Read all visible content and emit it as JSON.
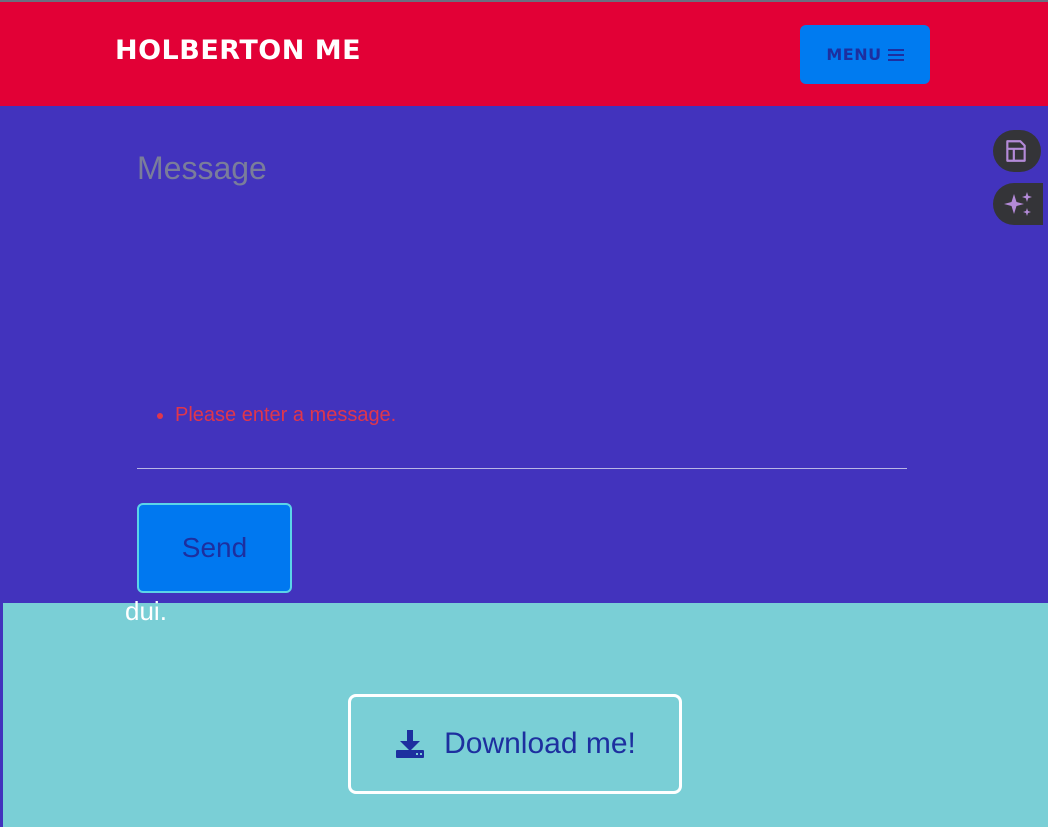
{
  "header": {
    "brand": "HOLBERTON ME",
    "menu_label": "MENU"
  },
  "contact_form": {
    "message_placeholder": "Message",
    "error_message": "Please enter a message.",
    "send_label": "Send"
  },
  "download_section": {
    "partial_text": "dui.",
    "download_label": "Download me!"
  },
  "floating_tools": {
    "icons": [
      "document-icon",
      "sparkle-icon"
    ]
  },
  "colors": {
    "navbar": "#e20036",
    "contact_background": "#4233bd",
    "accent_button": "#007bf0",
    "download_background": "#7acfd6",
    "error": "#e0364b"
  }
}
